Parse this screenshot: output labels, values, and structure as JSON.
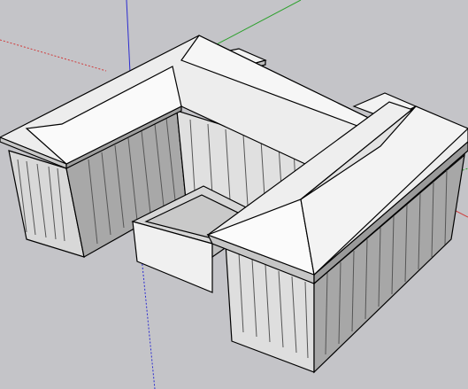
{
  "app": {
    "title": "",
    "viewport_label": ""
  },
  "scene": {
    "background": "#c4c4c8",
    "axis_colors": {
      "red": "#d03a3a",
      "green": "#2fa12f",
      "blue": "#2b2bd0"
    },
    "model": "building-complex",
    "faces": {
      "roof": "#f4f4f4",
      "roof_slope": "#e6e6e6",
      "wall_light": "#dcdcdc",
      "wall_dark": "#9b9b9b",
      "edge": "#000000"
    }
  }
}
